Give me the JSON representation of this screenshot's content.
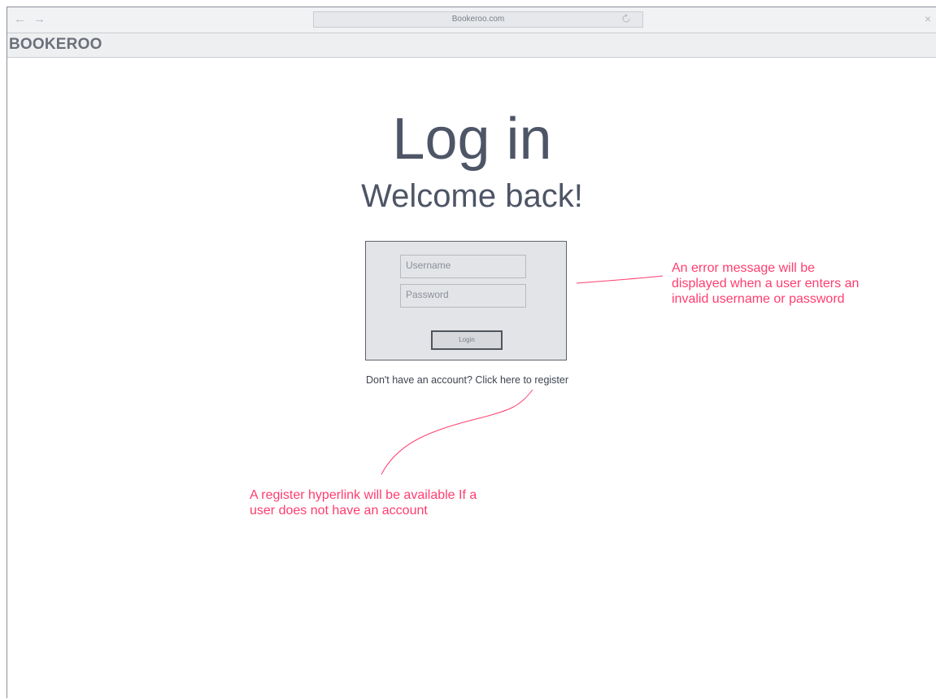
{
  "browser": {
    "url": "Bookeroo.com",
    "back_glyph": "←",
    "forward_glyph": "→",
    "close_glyph": "×"
  },
  "app": {
    "brand": "BOOKEROO"
  },
  "login": {
    "title": "Log in",
    "subtitle": "Welcome back!",
    "username_placeholder": "Username",
    "password_placeholder": "Password",
    "login_button": "Login",
    "register_prompt": "Don't have an account? Click here to register"
  },
  "annotations": {
    "error_note": "An error message will be displayed when a user enters an invalid username or password",
    "register_note": "A register hyperlink will be available If a user does not have an account",
    "color": "#ff3d6e"
  },
  "icons": {
    "back": "arrow-left-icon",
    "forward": "arrow-right-icon",
    "reload": "reload-icon",
    "close": "close-icon"
  }
}
